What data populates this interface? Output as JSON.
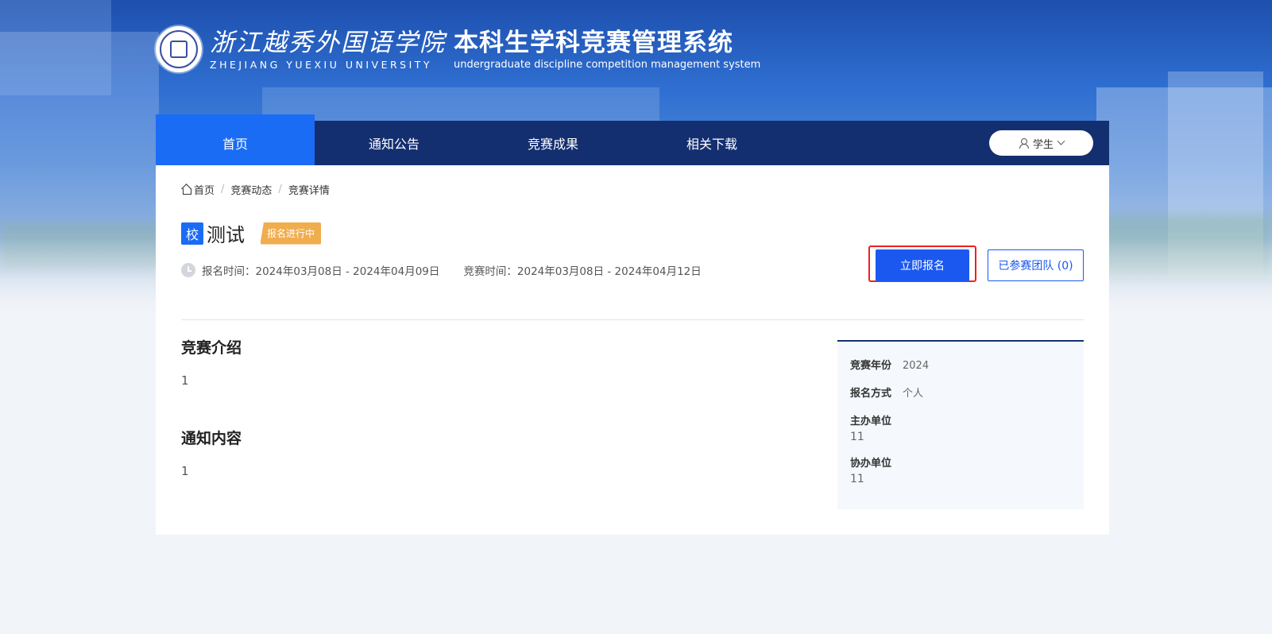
{
  "header": {
    "school_name_cn": "浙江越秀外国语学院",
    "school_name_en": "ZHEJIANG   YUEXIU   UNIVERSITY",
    "system_name_cn": "本科生学科竞赛管理系统",
    "system_name_en": "undergraduate discipline competition management system"
  },
  "nav": {
    "items": [
      {
        "label": "首页",
        "active": true
      },
      {
        "label": "通知公告",
        "active": false
      },
      {
        "label": "竞赛成果",
        "active": false
      },
      {
        "label": "相关下载",
        "active": false
      }
    ],
    "user_role": "学生"
  },
  "breadcrumb": [
    "首页",
    "竞赛动态",
    "竞赛详情"
  ],
  "competition": {
    "level_tag": "校",
    "title": "测试",
    "status": "报名进行中",
    "signup_time_label": "报名时间：",
    "signup_time": "2024年03月08日 - 2024年04月09日",
    "contest_time_label": "竞赛时间：",
    "contest_time": "2024年03月08日 - 2024年04月12日"
  },
  "actions": {
    "signup_label": "立即报名",
    "teams_label": "已参赛团队 (0)"
  },
  "sections": [
    {
      "title": "竞赛介绍",
      "body": "1"
    },
    {
      "title": "通知内容",
      "body": "1"
    }
  ],
  "info": {
    "year_label": "竞赛年份",
    "year": "2024",
    "mode_label": "报名方式",
    "mode": "个人",
    "host_label": "主办单位",
    "host": "11",
    "co_label": "协办单位",
    "co": "11"
  },
  "colors": {
    "nav_bg": "#142f70",
    "accent": "#1b6cf5",
    "primary_button": "#1b58f0",
    "status_badge": "#f0ad4e",
    "highlight_border": "#f02020"
  }
}
